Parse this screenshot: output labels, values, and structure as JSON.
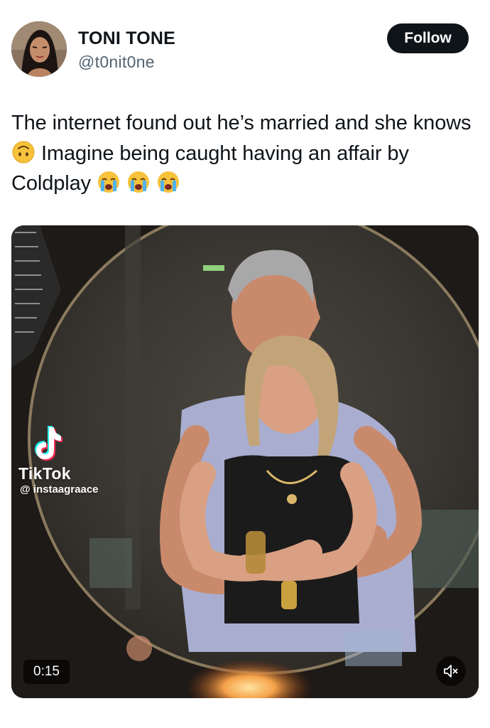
{
  "user": {
    "display_name": "TONI TONE",
    "handle": "@t0nit0ne"
  },
  "follow_label": "Follow",
  "tweet": {
    "text_1": "The internet found out he’s married and she knows",
    "text_2": "Imagine being caught having an affair by Coldplay",
    "emoji_1": "upside-down-face-icon",
    "emoji_2": "loudly-crying-face-icon"
  },
  "media": {
    "watermark_brand": "TikTok",
    "watermark_user": "@ instaagraace",
    "duration": "0:15",
    "mute_icon": "speaker-muted-icon"
  },
  "colors": {
    "text": "#0f1419",
    "secondary": "#536471",
    "button_bg": "#0f1419",
    "button_text": "#ffffff"
  }
}
